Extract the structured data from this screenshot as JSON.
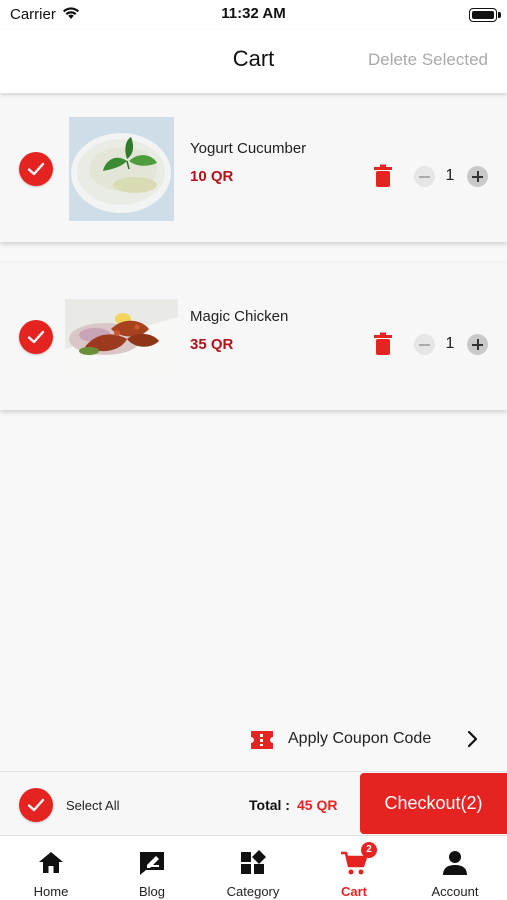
{
  "status_bar": {
    "carrier": "Carrier",
    "time": "11:32 AM"
  },
  "header": {
    "title": "Cart",
    "delete_selected": "Delete Selected"
  },
  "items": [
    {
      "name": "Yogurt Cucumber",
      "price": "10 QR",
      "quantity": "1",
      "selected": true
    },
    {
      "name": "Magic Chicken",
      "price": "35 QR",
      "quantity": "1",
      "selected": true
    }
  ],
  "coupon": {
    "label": "Apply Coupon Code"
  },
  "footer": {
    "select_all": "Select All",
    "total_label": "Total :",
    "total_value": "45 QR",
    "checkout": "Checkout(2)"
  },
  "tabs": [
    {
      "label": "Home",
      "icon": "home-icon"
    },
    {
      "label": "Blog",
      "icon": "blog-icon"
    },
    {
      "label": "Category",
      "icon": "category-icon"
    },
    {
      "label": "Cart",
      "icon": "cart-icon",
      "badge": "2",
      "active": true
    },
    {
      "label": "Account",
      "icon": "account-icon"
    }
  ],
  "colors": {
    "accent": "#e52421",
    "price": "#b3121b",
    "muted": "#a9a9a9"
  }
}
